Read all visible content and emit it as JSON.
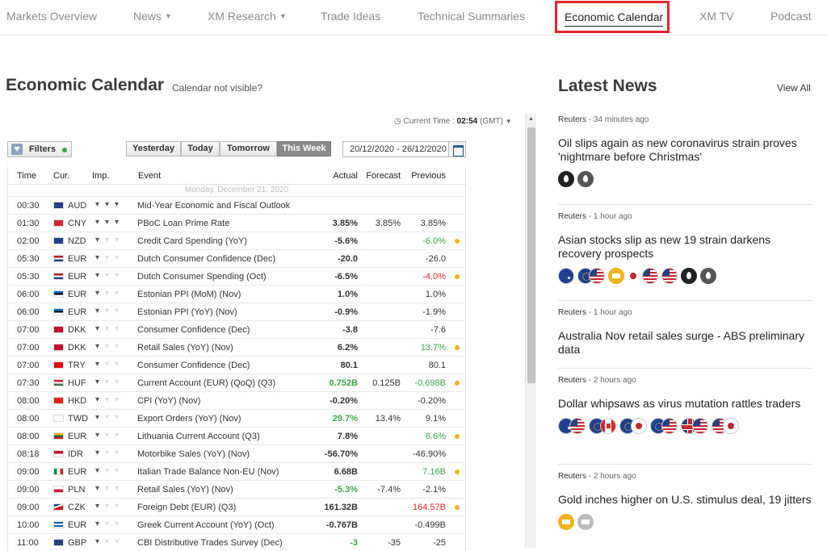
{
  "nav": {
    "items": [
      "Markets Overview",
      "News",
      "XM Research",
      "Trade Ideas",
      "Technical Summaries",
      "Economic Calendar",
      "XM TV",
      "Podcast"
    ],
    "active": "Economic Calendar"
  },
  "calendar": {
    "title": "Economic Calendar",
    "help_link": "Calendar not visible?",
    "current_time_label": "Current Time :",
    "current_time_value": "02:54",
    "timezone": "(GMT)",
    "filters_label": "Filters",
    "day_buttons": [
      "Yesterday",
      "Today",
      "Tomorrow",
      "This Week"
    ],
    "active_day_button": "This Week",
    "date_range": "20/12/2020 - 26/12/2020",
    "columns": [
      "Time",
      "Cur.",
      "Imp.",
      "Event",
      "Actual",
      "Forecast",
      "Previous"
    ],
    "day_header": "Monday, December 21, 2020",
    "rows": [
      {
        "time": "00:30",
        "flag": "au",
        "cur": "AUD",
        "imp": 3,
        "event": "Mid-Year Economic and Fiscal Outlook",
        "actual": "",
        "forecast": "",
        "previous": "",
        "actual_color": "",
        "previous_color": "",
        "dot": false
      },
      {
        "time": "01:30",
        "flag": "cn",
        "cur": "CNY",
        "imp": 3,
        "event": "PBoC Loan Prime Rate",
        "actual": "3.85%",
        "forecast": "3.85%",
        "previous": "3.85%",
        "actual_color": "",
        "previous_color": "",
        "dot": false
      },
      {
        "time": "02:00",
        "flag": "nz",
        "cur": "NZD",
        "imp": 1,
        "event": "Credit Card Spending (YoY)",
        "actual": "-5.6%",
        "forecast": "",
        "previous": "-6.0%",
        "actual_color": "",
        "previous_color": "green",
        "dot": true
      },
      {
        "time": "05:30",
        "flag": "nl",
        "cur": "EUR",
        "imp": 1,
        "event": "Dutch Consumer Confidence (Dec)",
        "actual": "-20.0",
        "forecast": "",
        "previous": "-26.0",
        "actual_color": "",
        "previous_color": "",
        "dot": false
      },
      {
        "time": "05:30",
        "flag": "nl",
        "cur": "EUR",
        "imp": 1,
        "event": "Dutch Consumer Spending (Oct)",
        "actual": "-6.5%",
        "forecast": "",
        "previous": "-4.0%",
        "actual_color": "",
        "previous_color": "red",
        "dot": true
      },
      {
        "time": "06:00",
        "flag": "ee",
        "cur": "EUR",
        "imp": 1,
        "event": "Estonian PPI (MoM) (Nov)",
        "actual": "1.0%",
        "forecast": "",
        "previous": "1.0%",
        "actual_color": "",
        "previous_color": "",
        "dot": false
      },
      {
        "time": "06:00",
        "flag": "ee",
        "cur": "EUR",
        "imp": 1,
        "event": "Estonian PPI (YoY) (Nov)",
        "actual": "-0.9%",
        "forecast": "",
        "previous": "-1.9%",
        "actual_color": "",
        "previous_color": "",
        "dot": false
      },
      {
        "time": "07:00",
        "flag": "dk",
        "cur": "DKK",
        "imp": 1,
        "event": "Consumer Confidence (Dec)",
        "actual": "-3.8",
        "forecast": "",
        "previous": "-7.6",
        "actual_color": "",
        "previous_color": "",
        "dot": false
      },
      {
        "time": "07:00",
        "flag": "dk",
        "cur": "DKK",
        "imp": 1,
        "event": "Retail Sales (YoY) (Nov)",
        "actual": "6.2%",
        "forecast": "",
        "previous": "13.7%",
        "actual_color": "",
        "previous_color": "green",
        "dot": true
      },
      {
        "time": "07:00",
        "flag": "tr",
        "cur": "TRY",
        "imp": 1,
        "event": "Consumer Confidence (Dec)",
        "actual": "80.1",
        "forecast": "",
        "previous": "80.1",
        "actual_color": "",
        "previous_color": "",
        "dot": false
      },
      {
        "time": "07:30",
        "flag": "hu",
        "cur": "HUF",
        "imp": 1,
        "event": "Current Account (EUR) (QoQ) (Q3)",
        "actual": "0.752B",
        "forecast": "0.125B",
        "previous": "-0.698B",
        "actual_color": "green",
        "previous_color": "green",
        "dot": true
      },
      {
        "time": "08:00",
        "flag": "hk",
        "cur": "HKD",
        "imp": 1,
        "event": "CPI (YoY) (Nov)",
        "actual": "-0.20%",
        "forecast": "",
        "previous": "-0.20%",
        "actual_color": "",
        "previous_color": "",
        "dot": false
      },
      {
        "time": "08:00",
        "flag": "tw",
        "cur": "TWD",
        "imp": 1,
        "event": "Export Orders (YoY) (Nov)",
        "actual": "29.7%",
        "forecast": "13.4%",
        "previous": "9.1%",
        "actual_color": "green",
        "previous_color": "",
        "dot": false
      },
      {
        "time": "08:00",
        "flag": "lt",
        "cur": "EUR",
        "imp": 1,
        "event": "Lithuania Current Account (Q3)",
        "actual": "7.8%",
        "forecast": "",
        "previous": "6.6%",
        "actual_color": "",
        "previous_color": "green",
        "dot": true
      },
      {
        "time": "08:18",
        "flag": "id",
        "cur": "IDR",
        "imp": 1,
        "event": "Motorbike Sales (YoY) (Nov)",
        "actual": "-56.70%",
        "forecast": "",
        "previous": "-46.90%",
        "actual_color": "",
        "previous_color": "",
        "dot": false
      },
      {
        "time": "09:00",
        "flag": "it",
        "cur": "EUR",
        "imp": 1,
        "event": "Italian Trade Balance Non-EU (Nov)",
        "actual": "6.68B",
        "forecast": "",
        "previous": "7.16B",
        "actual_color": "",
        "previous_color": "green",
        "dot": true
      },
      {
        "time": "09:00",
        "flag": "pl",
        "cur": "PLN",
        "imp": 1,
        "event": "Retail Sales (YoY) (Nov)",
        "actual": "-5.3%",
        "forecast": "-7.4%",
        "previous": "-2.1%",
        "actual_color": "green",
        "previous_color": "",
        "dot": false
      },
      {
        "time": "09:00",
        "flag": "cz",
        "cur": "CZK",
        "imp": 1,
        "event": "Foreign Debt (EUR) (Q3)",
        "actual": "161.32B",
        "forecast": "",
        "previous": "164.57B",
        "actual_color": "",
        "previous_color": "red",
        "dot": true
      },
      {
        "time": "10:00",
        "flag": "gr",
        "cur": "EUR",
        "imp": 1,
        "event": "Greek Current Account (YoY) (Oct)",
        "actual": "-0.767B",
        "forecast": "",
        "previous": "-0.499B",
        "actual_color": "",
        "previous_color": "",
        "dot": false
      },
      {
        "time": "11:00",
        "flag": "gb",
        "cur": "GBP",
        "imp": 1,
        "event": "CBI Distributive Trades Survey (Dec)",
        "actual": "-3",
        "forecast": "-35",
        "previous": "-25",
        "actual_color": "green",
        "previous_color": "",
        "dot": false
      }
    ]
  },
  "news": {
    "title": "Latest News",
    "view_all": "View All",
    "items": [
      {
        "source": "Reuters",
        "age": "34 minutes ago",
        "headline": "Oil slips again as new coronavirus strain proves 'nightmare before Christmas'",
        "icons": [
          "oil-icon",
          "oil-gray-icon"
        ]
      },
      {
        "source": "Reuters",
        "age": "1 hour ago",
        "headline": "Asian stocks slip as new 19 strain darkens recovery prospects",
        "icons": [
          "aud-icon",
          "eurusd-icon",
          "gold-icon",
          "jpy-small-icon",
          "usd-icon",
          "usd-icon",
          "oil-icon",
          "oil-gray-icon"
        ]
      },
      {
        "source": "Reuters",
        "age": "1 hour ago",
        "headline": "Australia Nov retail sales surge - ABS preliminary data",
        "icons": []
      },
      {
        "source": "Reuters",
        "age": "2 hours ago",
        "headline": "Dollar whipsaws as virus mutation rattles traders",
        "icons": [
          "audusd-icon",
          "eurcad-icon",
          "eurjpy-icon",
          "eurusd-icon",
          "gbpusd-icon",
          "usdjpy-icon"
        ]
      },
      {
        "source": "Reuters",
        "age": "2 hours ago",
        "headline": "Gold inches higher on U.S. stimulus deal, 19 jitters",
        "icons": [
          "gold-icon",
          "silver-icon"
        ]
      }
    ]
  },
  "colors": {
    "accent_red": "#e3262c",
    "positive": "#3aa646",
    "negative": "#e3262c",
    "dot": "#f1b21f"
  }
}
